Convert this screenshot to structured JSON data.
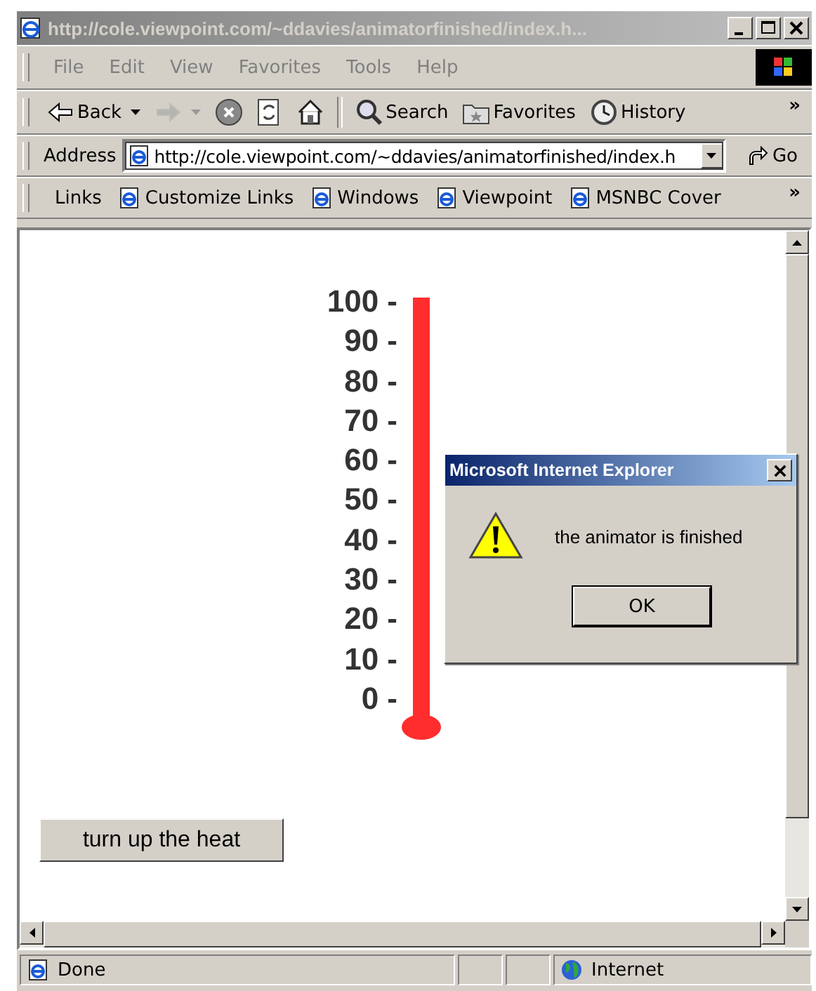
{
  "window": {
    "title": "http://cole.viewpoint.com/~ddavies/animatorfinished/index.h...",
    "active": false
  },
  "menu": [
    "File",
    "Edit",
    "View",
    "Favorites",
    "Tools",
    "Help"
  ],
  "toolbar": [
    {
      "kind": "back",
      "label": "Back",
      "disabled": false,
      "has_menu": true
    },
    {
      "kind": "forward",
      "disabled": true,
      "has_menu": true
    },
    {
      "kind": "stop",
      "disabled": false
    },
    {
      "kind": "refresh",
      "disabled": false
    },
    {
      "kind": "home",
      "disabled": false
    },
    {
      "kind": "search",
      "label": "Search",
      "disabled": false
    },
    {
      "kind": "favorites",
      "label": "Favorites",
      "disabled": false
    },
    {
      "kind": "history",
      "label": "History",
      "disabled": false
    }
  ],
  "toolbar_more": "»",
  "address": {
    "label": "Address",
    "value": "http://cole.viewpoint.com/~ddavies/animatorfinished/index.h",
    "go": "Go"
  },
  "links": {
    "label": "Links",
    "items": [
      "Customize Links",
      "Windows",
      "Viewpoint",
      "MSNBC Cover"
    ],
    "more": "»"
  },
  "page": {
    "thermometer": {
      "scale": [
        "100 -",
        "90 -",
        "80 -",
        "70 -",
        "60 -",
        "50 -",
        "40 -",
        "30 -",
        "20 -",
        "10 -",
        "0 -"
      ],
      "level": 1
    },
    "button": "turn up the heat"
  },
  "dialog": {
    "title": "Microsoft Internet Explorer",
    "message": "the animator is finished",
    "button": "OK"
  },
  "status_bar": {
    "text": "Done",
    "zone": "Internet"
  }
}
